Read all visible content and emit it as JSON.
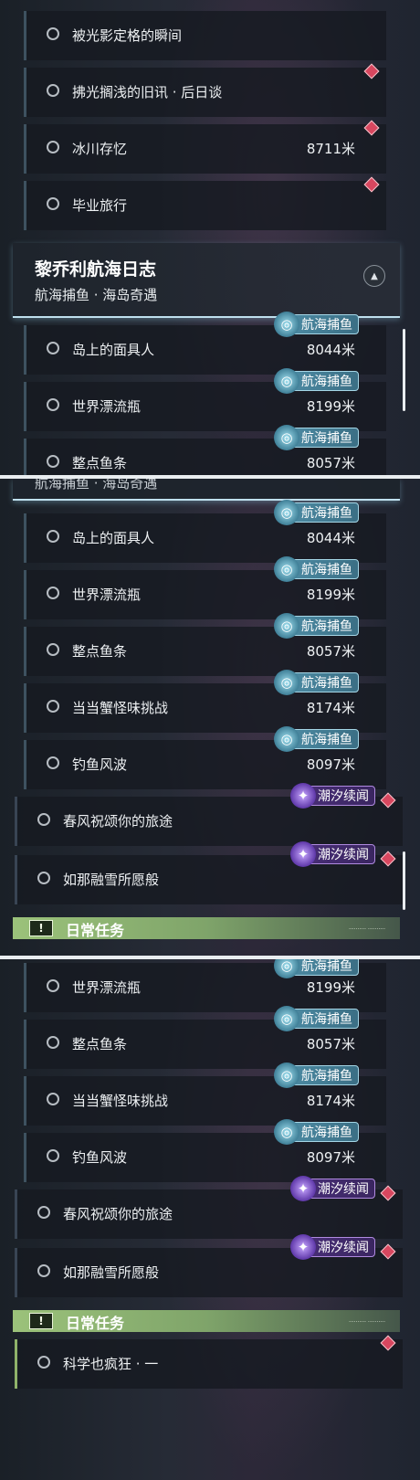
{
  "quests": {
    "q1": {
      "label": "被光影定格的瞬间"
    },
    "q2": {
      "label": "拂光搁浅的旧讯 · 后日谈"
    },
    "q3": {
      "label": "冰川存忆",
      "distance": "8711米"
    },
    "q4": {
      "label": "毕业旅行"
    },
    "fish_island": {
      "label": "岛上的面具人",
      "distance": "8044米"
    },
    "fish_bottle": {
      "label": "世界漂流瓶",
      "distance": "8199米"
    },
    "fish_hour": {
      "label": "整点鱼条",
      "distance": "8057米"
    },
    "fish_crab": {
      "label": "当当蟹怪味挑战",
      "distance": "8174米"
    },
    "fish_wave": {
      "label": "钓鱼风波",
      "distance": "8097米"
    },
    "tide_spring": {
      "label": "春风祝颂你的旅途"
    },
    "tide_snow": {
      "label": "如那融雪所愿般"
    },
    "daily_science": {
      "label": "科学也疯狂 · 一"
    }
  },
  "group": {
    "title": "黎乔利航海日志",
    "subtitle": "航海捕鱼 · 海岛奇遇",
    "toggle_icon": "collapse-arrow-icon"
  },
  "badges": {
    "fish": "航海捕鱼",
    "tide": "潮汐续闻"
  },
  "daily": {
    "label": "日常任务",
    "flag": "!",
    "small_text": "..........  ..........",
    "accent": "#8fb36a"
  },
  "colors": {
    "fish_badge": "#4f8fa8",
    "tide_badge": "#4a2f7a",
    "diamond": "#d8475f",
    "header_glow": "#bfe0ee"
  }
}
